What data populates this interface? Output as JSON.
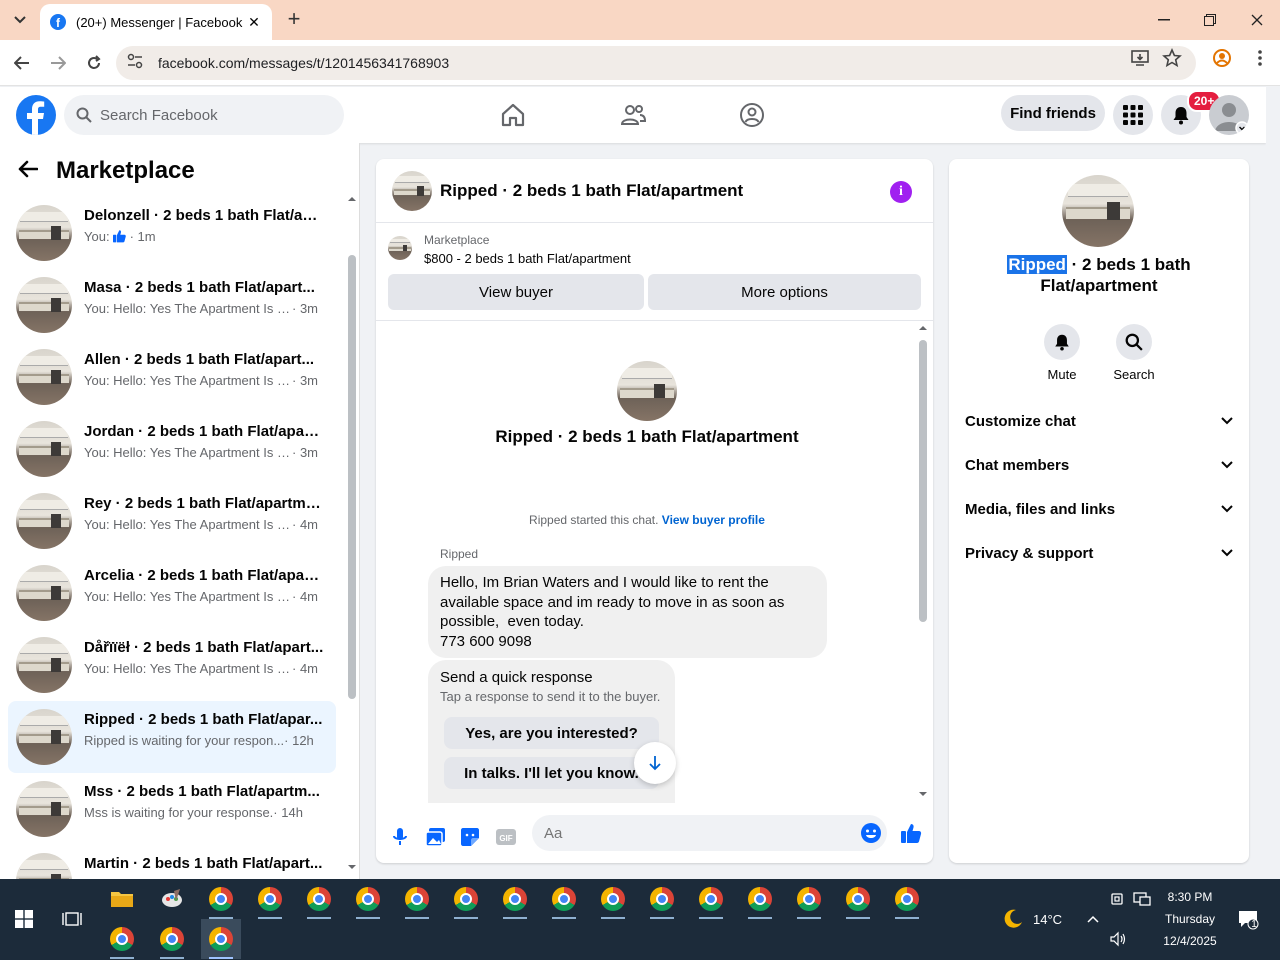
{
  "browser": {
    "tab_title": "(20+) Messenger | Facebook",
    "url": "facebook.com/messages/t/1201456341768903"
  },
  "fb": {
    "search_placeholder": "Search Facebook",
    "find_friends": "Find friends",
    "notif_badge": "20+"
  },
  "marketplace": {
    "title": "Marketplace",
    "conversations": [
      {
        "name": "Delonzell · 2 beds 1 bath Flat/ap...",
        "preview": "You:",
        "time": "· 1m",
        "like": true
      },
      {
        "name": "Masa · 2 beds 1 bath Flat/apart...",
        "preview": "You: Hello: Yes The Apartment Is St...",
        "time": "· 3m"
      },
      {
        "name": "Allen · 2 beds 1 bath Flat/apart...",
        "preview": "You: Hello: Yes The Apartment Is St...",
        "time": "· 3m"
      },
      {
        "name": "Jordan · 2 beds 1 bath Flat/apart...",
        "preview": "You: Hello: Yes The Apartment Is St...",
        "time": "· 3m"
      },
      {
        "name": "Rey · 2 beds 1 bath Flat/apartment",
        "preview": "You: Hello: Yes The Apartment Is St...",
        "time": "· 4m"
      },
      {
        "name": "Arcelia · 2 beds 1 bath Flat/apart...",
        "preview": "You: Hello: Yes The Apartment Is St...",
        "time": "· 4m"
      },
      {
        "name": "Dåřïïëł · 2 beds 1 bath Flat/apart...",
        "preview": "You: Hello: Yes The Apartment Is St...",
        "time": "· 4m"
      },
      {
        "name": "Ripped · 2 beds 1 bath Flat/apar...",
        "preview": "Ripped is waiting for your respon...",
        "time": "· 12h",
        "active": true
      },
      {
        "name": "Mss · 2 beds 1 bath Flat/apartm...",
        "preview": "Mss is waiting for your response.",
        "time": "· 14h"
      },
      {
        "name": "Martin · 2 beds 1 bath Flat/apart...",
        "preview": "",
        "time": ""
      }
    ]
  },
  "chat": {
    "title": "Ripped · 2 beds 1 bath Flat/apartment",
    "listing_source": "Marketplace",
    "listing_price": "$800 - 2 beds 1 bath Flat/apartment",
    "view_buyer": "View buyer",
    "more_options": "More options",
    "big_title": "Ripped · 2 beds 1 bath Flat/apartment",
    "started_text": "Ripped started this chat.",
    "view_profile": "View buyer profile",
    "sender": "Ripped",
    "message_lines": [
      "Hello, Im Brian Waters and I would like to rent the",
      "available space and im ready to move in as soon as",
      "possible,  even today.",
      "773 600 9098"
    ],
    "quick_title": "Send a quick response",
    "quick_sub": "Tap a response to send it to the buyer.",
    "quick_replies": [
      "Yes, are you interested?",
      "In talks. I'll let you know."
    ],
    "composer_placeholder": "Aa"
  },
  "details": {
    "name_highlight": "Ripped",
    "name_line1_rest": " · 2 beds 1 bath",
    "name_line2": "Flat/apartment",
    "mute": "Mute",
    "search": "Search",
    "sections": [
      "Customize chat",
      "Chat members",
      "Media, files and links",
      "Privacy & support"
    ]
  },
  "taskbar": {
    "temp": "14°C",
    "time": "8:30 PM",
    "day": "Thursday",
    "date": "12/4/2025",
    "notif_count": "1"
  },
  "colors": {
    "fb_blue": "#1877f2",
    "link_blue": "#0064d1",
    "info_purple": "#a020f0",
    "badge_red": "#e41e3f",
    "active_row": "#ebf5ff",
    "tab_strip": "#f9d7c4",
    "taskbar": "#1c2b3a"
  }
}
